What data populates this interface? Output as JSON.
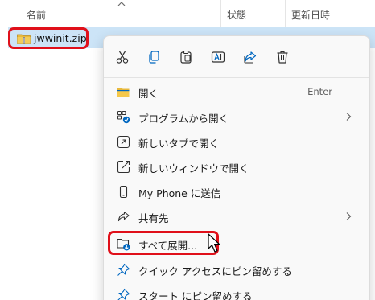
{
  "header": {
    "name_col": "名前",
    "status_col": "状態",
    "date_col": "更新日時"
  },
  "file": {
    "name": "jwwinit.zip",
    "status_glyph": "Ω",
    "date_glyph": "- - -"
  },
  "toolbar": {
    "icons": [
      "cut-icon",
      "copy-icon",
      "paste-icon",
      "rename-icon",
      "share-icon",
      "delete-icon"
    ]
  },
  "menu": {
    "items": [
      {
        "label": "開く",
        "accel": "Enter"
      },
      {
        "label": "プログラムから開く",
        "submenu": true
      },
      {
        "label": "新しいタブで開く"
      },
      {
        "label": "新しいウィンドウで開く"
      },
      {
        "label": "My Phone に送信"
      },
      {
        "label": "共有先",
        "submenu": true
      },
      {
        "label": "すべて展開..."
      },
      {
        "label": "クイック アクセスにピン留めする"
      },
      {
        "label": "スタート にピン留めする"
      }
    ]
  },
  "colors": {
    "highlight": "#e0101a",
    "selection": "#cce4f7",
    "accent": "#0067c0",
    "folder": "#e8b93c"
  }
}
